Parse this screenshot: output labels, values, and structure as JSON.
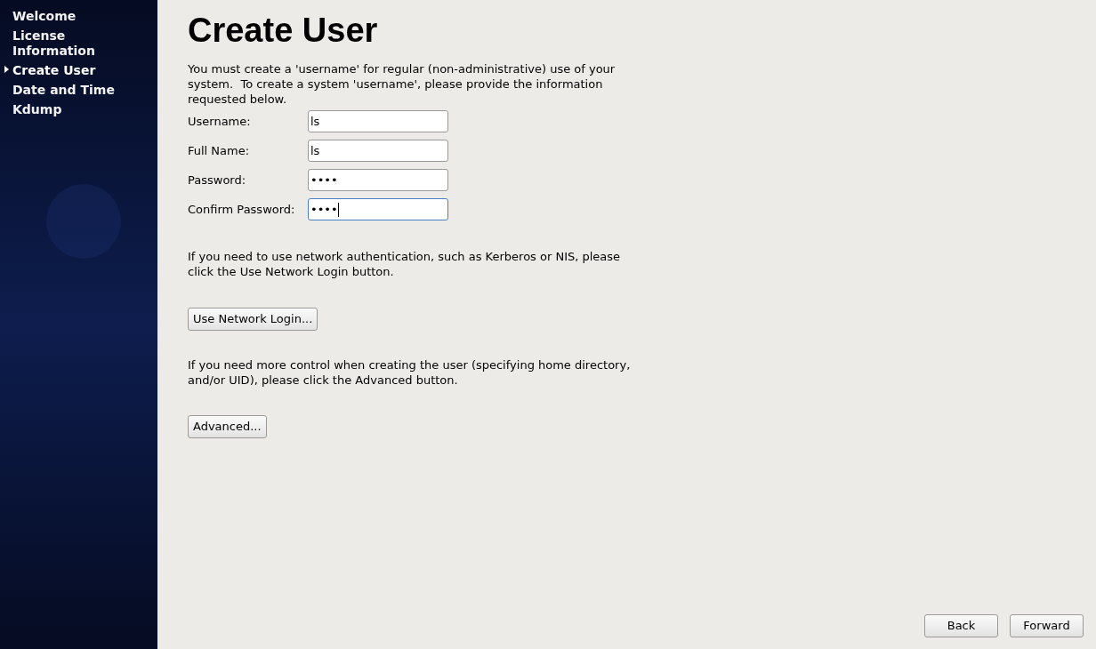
{
  "sidebar": {
    "items": [
      {
        "label": "Welcome",
        "selected": false
      },
      {
        "label": "License Information",
        "selected": false
      },
      {
        "label": "Create User",
        "selected": true
      },
      {
        "label": "Date and Time",
        "selected": false
      },
      {
        "label": "Kdump",
        "selected": false
      }
    ]
  },
  "title": "Create User",
  "intro": "You must create a 'username' for regular (non-administrative) use of your system.  To create a system 'username', please provide the information requested below.",
  "fields": [
    {
      "label": "Username:",
      "value": "ls",
      "focused": false
    },
    {
      "label": "Full Name:",
      "value": "ls",
      "focused": false
    },
    {
      "label": "Password:",
      "value": "••••",
      "focused": false
    },
    {
      "label": "Confirm Password:",
      "value": "••••",
      "focused": true
    }
  ],
  "network_text": "If you need to use network authentication, such as Kerberos or NIS, please click the Use Network Login button.",
  "network_button": "Use Network Login...",
  "advanced_text": "If you need more control when creating the user (specifying home directory, and/or UID), please click the Advanced button.",
  "advanced_button": "Advanced...",
  "nav_buttons": [
    "Back",
    "Forward"
  ]
}
